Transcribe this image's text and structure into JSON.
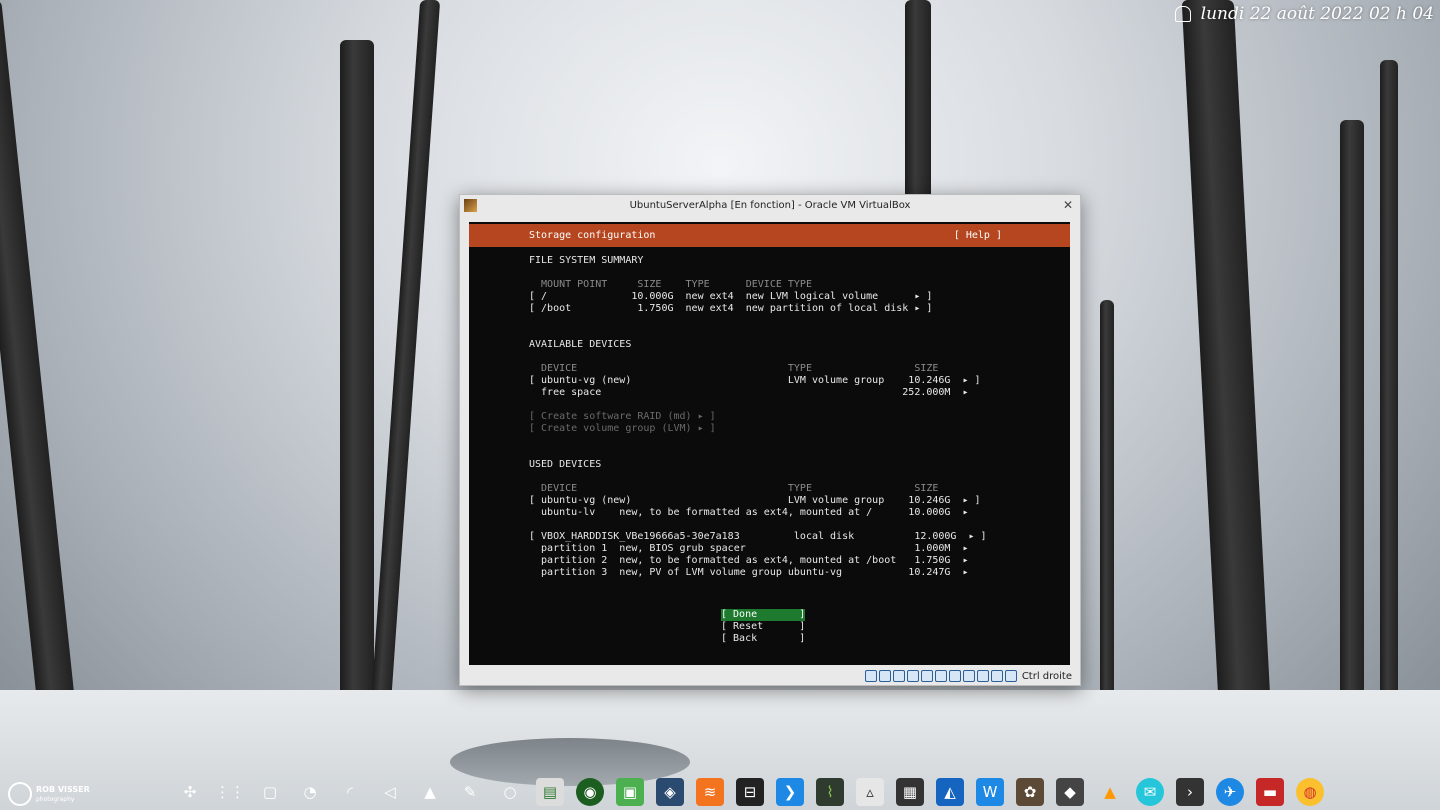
{
  "desktop": {
    "clock": "lundi 22 août 2022 02 h 04",
    "wallpaper_credit": "ROB VISSER",
    "wallpaper_credit_sub": "photography"
  },
  "window": {
    "title": "UbuntuServerAlpha [En fonction] - Oracle VM VirtualBox",
    "host_key": "Ctrl droite"
  },
  "installer": {
    "header_title": "Storage configuration",
    "help": "[ Help ]",
    "fs_summary_heading": "FILE SYSTEM SUMMARY",
    "fs_columns": "  MOUNT POINT     SIZE    TYPE      DEVICE TYPE",
    "fs_rows": [
      "[ /              10.000G  new ext4  new LVM logical volume      ▸ ]",
      "[ /boot           1.750G  new ext4  new partition of local disk ▸ ]"
    ],
    "available_heading": "AVAILABLE DEVICES",
    "available_columns": "  DEVICE                                   TYPE                 SIZE",
    "available_rows": [
      "[ ubuntu-vg (new)                          LVM volume group    10.246G  ▸ ]",
      "  free space                                                  252.000M  ▸"
    ],
    "create_raid": "[ Create software RAID (md) ▸ ]",
    "create_vg": "[ Create volume group (LVM) ▸ ]",
    "used_heading": "USED DEVICES",
    "used_columns": "  DEVICE                                   TYPE                 SIZE",
    "used_rows": [
      "[ ubuntu-vg (new)                          LVM volume group    10.246G  ▸ ]",
      "  ubuntu-lv    new, to be formatted as ext4, mounted at /      10.000G  ▸",
      "[ VBOX_HARDDISK_VBe19666a5-30e7a183         local disk          12.000G  ▸ ]",
      "  partition 1  new, BIOS grub spacer                            1.000M  ▸",
      "  partition 2  new, to be formatted as ext4, mounted at /boot   1.750G  ▸",
      "  partition 3  new, PV of LVM volume group ubuntu-vg           10.247G  ▸"
    ],
    "buttons": {
      "done": "[ Done       ]",
      "reset": "[ Reset      ]",
      "back": "[ Back       ]"
    }
  },
  "taskbar": {
    "icons": [
      "launcher-icon",
      "app-grid-icon",
      "screen-icon",
      "network-icon",
      "wifi-icon",
      "volume-icon",
      "arrow-icon",
      "pen-icon",
      "circle-icon",
      "notes-icon",
      "globe-icon",
      "lock-app-icon",
      "virtualbox-icon",
      "stack-app-icon",
      "terminal-panel-icon",
      "folder-blue-icon",
      "chart-app-icon",
      "inkscape-icon",
      "calculator-icon",
      "ide-icon",
      "writer-icon",
      "gimp-icon",
      "ink-icon",
      "vlc-icon",
      "mail-icon",
      "terminal-icon",
      "compass-icon",
      "files-icon",
      "chrome-icon"
    ]
  },
  "colors": {
    "header_bg": "#b5461f",
    "selected_button_bg": "#1d7a2e",
    "terminal_bg": "#0b0b0b"
  }
}
